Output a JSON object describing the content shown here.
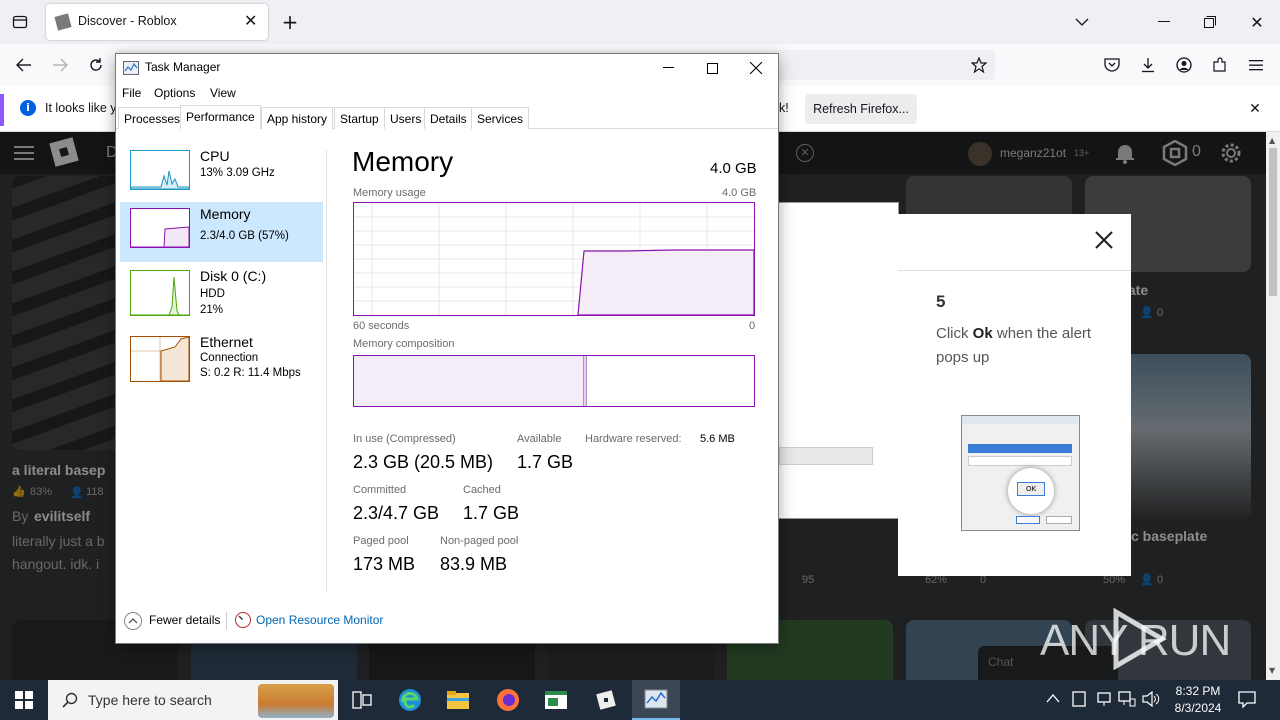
{
  "firefox": {
    "tab_title": "Discover - Roblox",
    "notification_text": "It looks like y",
    "notification_tail": "k!",
    "refresh_button": "Refresh Firefox..."
  },
  "roblox": {
    "header_letter": "D",
    "username": "meganz21ot",
    "age_tag": "13+",
    "robux": "0",
    "cards": [
      {
        "title": "a literal basep",
        "rating": "83%",
        "players": "118",
        "by_label": "By",
        "creator": "evilitself",
        "desc1": "literally just a b",
        "desc2": "hangout. idk. i"
      },
      {
        "title": "late",
        "players": "0"
      },
      {
        "title": "c baseplate",
        "rating": "50%",
        "players": "0"
      }
    ],
    "hidden_counts": [
      "95",
      "62%",
      "0"
    ],
    "chat_label": "Chat"
  },
  "tutorial": {
    "step": "5",
    "text_pre": "Click ",
    "text_bold": "Ok",
    "text_post": " when the alert pops up",
    "ok_label": "OK"
  },
  "taskmgr": {
    "title": "Task Manager",
    "menu": [
      "File",
      "Options",
      "View"
    ],
    "tabs": [
      "Processes",
      "Performance",
      "App history",
      "Startup",
      "Users",
      "Details",
      "Services"
    ],
    "sidebar": [
      {
        "name": "CPU",
        "line1": "13%  3.09 GHz",
        "line2": ""
      },
      {
        "name": "Memory",
        "line1": "2.3/4.0 GB (57%)",
        "line2": ""
      },
      {
        "name": "Disk 0 (C:)",
        "line1": "HDD",
        "line2": "21%"
      },
      {
        "name": "Ethernet",
        "line1": "Connection",
        "line2": "S: 0.2  R: 11.4 Mbps"
      }
    ],
    "heading": "Memory",
    "total": "4.0 GB",
    "usage_label": "Memory usage",
    "usage_max": "4.0 GB",
    "axis_left": "60 seconds",
    "axis_right": "0",
    "composition_label": "Memory composition",
    "stats": {
      "in_use_label": "In use (Compressed)",
      "in_use": "2.3 GB (20.5 MB)",
      "available_label": "Available",
      "available": "1.7 GB",
      "hw_label": "Hardware reserved:",
      "hw": "5.6 MB",
      "committed_label": "Committed",
      "committed": "2.3/4.7 GB",
      "cached_label": "Cached",
      "cached": "1.7 GB",
      "paged_label": "Paged pool",
      "paged": "173 MB",
      "nonpaged_label": "Non-paged pool",
      "nonpaged": "83.9 MB"
    },
    "fewer_details": "Fewer details",
    "resource_monitor": "Open Resource Monitor"
  },
  "taskbar": {
    "search_placeholder": "Type here to search",
    "time": "8:32 PM",
    "date": "8/3/2024"
  },
  "watermark": "ANY RUN"
}
